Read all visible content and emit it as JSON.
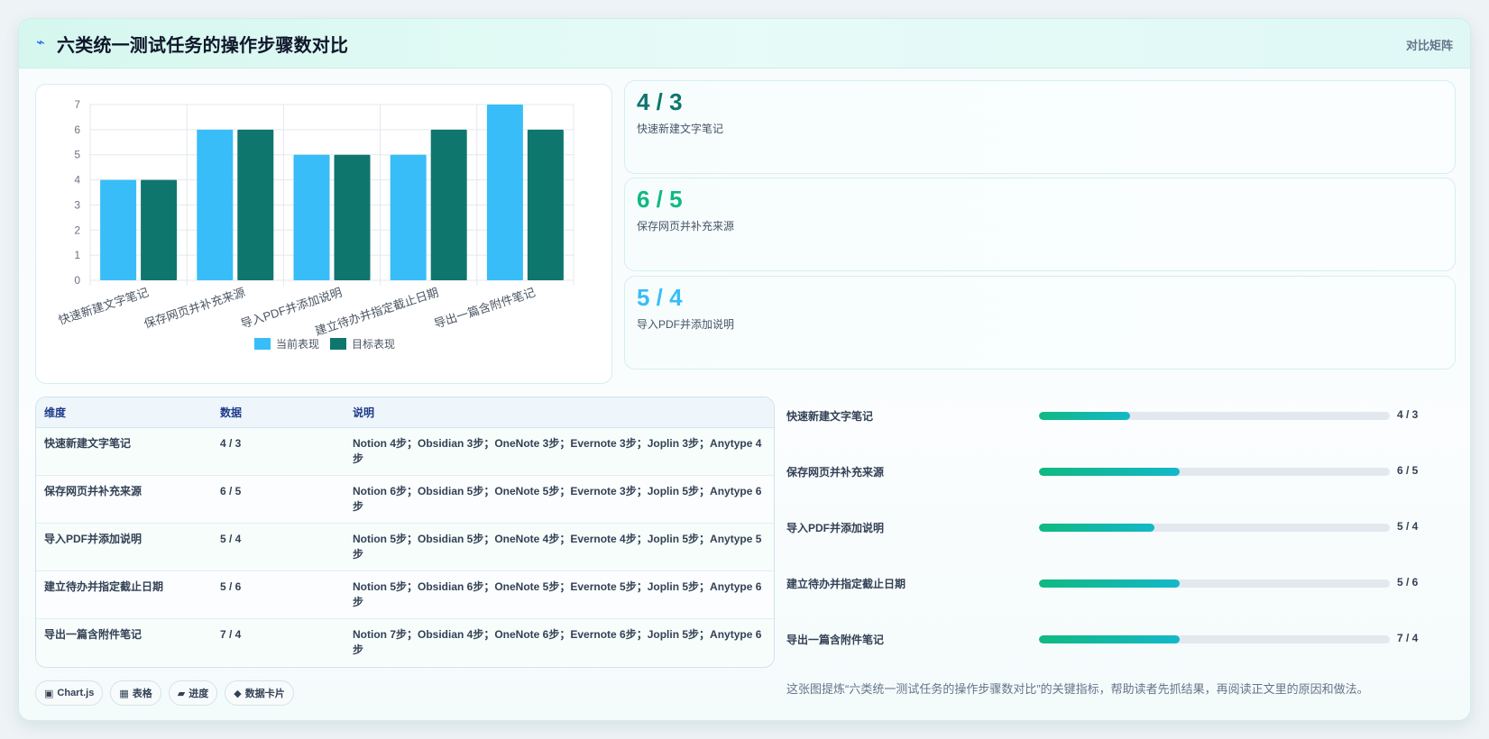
{
  "header": {
    "icon": "lightning-icon",
    "title": "六类统一测试任务的操作步骤数对比",
    "tag": "对比矩阵"
  },
  "chart_data": {
    "type": "bar",
    "categories": [
      "快速新建文字笔记",
      "保存网页并补充来源",
      "导入PDF并添加说明",
      "建立待办并指定截止日期",
      "导出一篇含附件笔记"
    ],
    "series": [
      {
        "name": "当前表现",
        "values": [
          4,
          6,
          5,
          5,
          7
        ],
        "color": "#38bdf8"
      },
      {
        "name": "目标表现",
        "values": [
          4,
          6,
          5,
          6,
          6
        ],
        "color": "#0f766e"
      }
    ],
    "ylim": [
      0,
      7
    ],
    "yticks": [
      "0",
      "1",
      "2",
      "3",
      "4",
      "5",
      "6",
      "7"
    ],
    "grid": true,
    "legend": "bottom",
    "title": "",
    "xlabel": "",
    "ylabel": ""
  },
  "kpis": [
    {
      "value": "4 / 3",
      "label": "快速新建文字笔记",
      "color": "#0f766e"
    },
    {
      "value": "6 / 5",
      "label": "保存网页并补充来源",
      "color": "#10b981"
    },
    {
      "value": "5 / 4",
      "label": "导入PDF并添加说明",
      "color": "#38bdf8"
    }
  ],
  "table": {
    "headers": [
      "维度",
      "数据",
      "说明"
    ],
    "rows": [
      [
        "快速新建文字笔记",
        "4 / 3",
        "Notion 4步；Obsidian 3步；OneNote 3步；Evernote 3步；Joplin 3步；Anytype 4步"
      ],
      [
        "保存网页并补充来源",
        "6 / 5",
        "Notion 6步；Obsidian 5步；OneNote 5步；Evernote 3步；Joplin 5步；Anytype 6步"
      ],
      [
        "导入PDF并添加说明",
        "5 / 4",
        "Notion 5步；Obsidian 5步；OneNote 4步；Evernote 4步；Joplin 5步；Anytype 5步"
      ],
      [
        "建立待办并指定截止日期",
        "5 / 6",
        "Notion 5步；Obsidian 6步；OneNote 5步；Evernote 5步；Joplin 5步；Anytype 6步"
      ],
      [
        "导出一篇含附件笔记",
        "7 / 4",
        "Notion 7步；Obsidian 4步；OneNote 6步；Evernote 6步；Joplin 5步；Anytype 6步"
      ]
    ]
  },
  "progress": [
    {
      "label": "快速新建文字笔记",
      "value": "4 / 3",
      "fraction": 0.26
    },
    {
      "label": "保存网页并补充来源",
      "value": "6 / 5",
      "fraction": 0.4
    },
    {
      "label": "导入PDF并添加说明",
      "value": "5 / 4",
      "fraction": 0.33
    },
    {
      "label": "建立待办并指定截止日期",
      "value": "5 / 6",
      "fraction": 0.4
    },
    {
      "label": "导出一篇含附件笔记",
      "value": "7 / 4",
      "fraction": 0.4
    }
  ],
  "tags": [
    {
      "icon": "▣",
      "label": "Chart.js"
    },
    {
      "icon": "▦",
      "label": "表格"
    },
    {
      "icon": "▰",
      "label": "进度"
    },
    {
      "icon": "◆",
      "label": "数据卡片"
    }
  ],
  "summary": "这张图提炼“六类统一测试任务的操作步骤数对比”的关键指标，帮助读者先抓结果，再阅读正文里的原因和做法。"
}
